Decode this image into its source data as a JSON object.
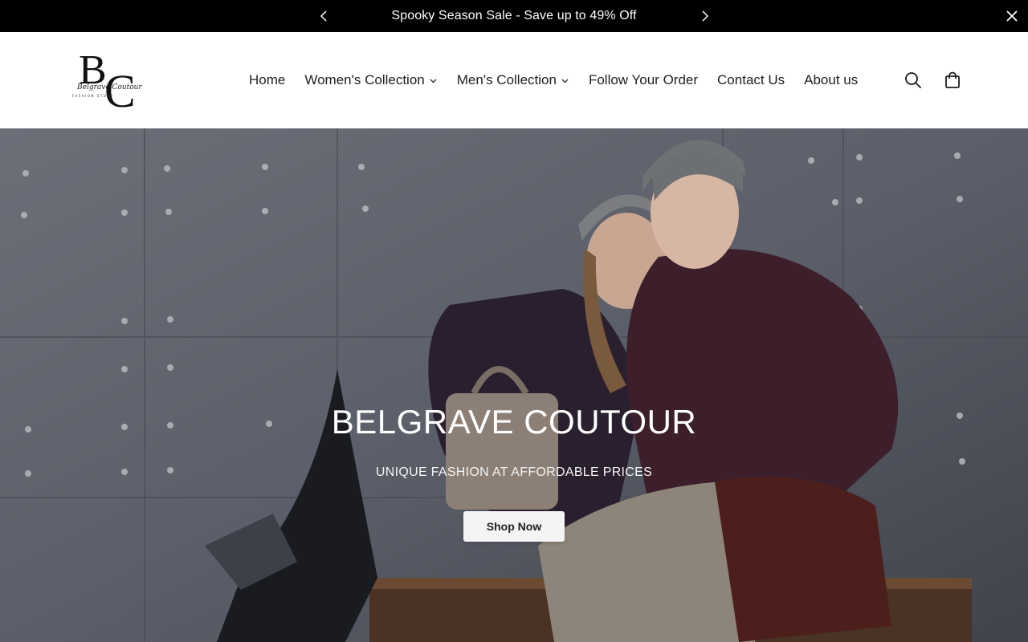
{
  "announcement": {
    "text": "Spooky Season Sale - Save up to 49% Off",
    "prev_icon": "chevron-left-icon",
    "next_icon": "chevron-right-icon",
    "close_icon": "close-icon"
  },
  "header": {
    "logo": {
      "monogram": "BC",
      "script": "Belgrave Coutour",
      "tagline": "FASHION STORE"
    },
    "nav": [
      {
        "label": "Home",
        "has_dropdown": false
      },
      {
        "label": "Women's Collection",
        "has_dropdown": true
      },
      {
        "label": "Men's Collection",
        "has_dropdown": true
      },
      {
        "label": "Follow Your Order",
        "has_dropdown": false
      },
      {
        "label": "Contact Us",
        "has_dropdown": false
      },
      {
        "label": "About us",
        "has_dropdown": false
      }
    ],
    "icons": [
      "search-icon",
      "cart-icon"
    ]
  },
  "hero": {
    "title": "BELGRAVE COUTOUR",
    "subtitle": "UNIQUE FASHION AT AFFORDABLE PRICES",
    "cta_label": "Shop Now"
  },
  "colors": {
    "announcement_bg": "#000000",
    "header_bg": "#ffffff",
    "button_bg": "#f4f4f4",
    "text_dark": "#1f1f1f"
  }
}
